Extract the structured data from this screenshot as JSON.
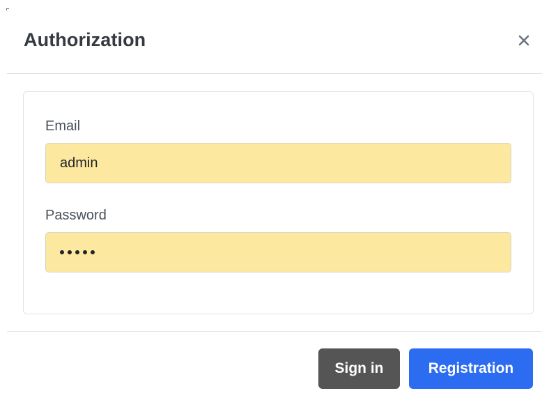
{
  "modal": {
    "title": "Authorization",
    "close_icon": "close-icon"
  },
  "form": {
    "email": {
      "label": "Email",
      "value": "admin"
    },
    "password": {
      "label": "Password",
      "masked_length": 5
    }
  },
  "footer": {
    "sign_in_label": "Sign in",
    "registration_label": "Registration"
  },
  "colors": {
    "input_autofill_bg": "#fde8a0",
    "sign_in_bg": "#555555",
    "registration_bg": "#2b6cf0",
    "title_color": "#343a40"
  }
}
